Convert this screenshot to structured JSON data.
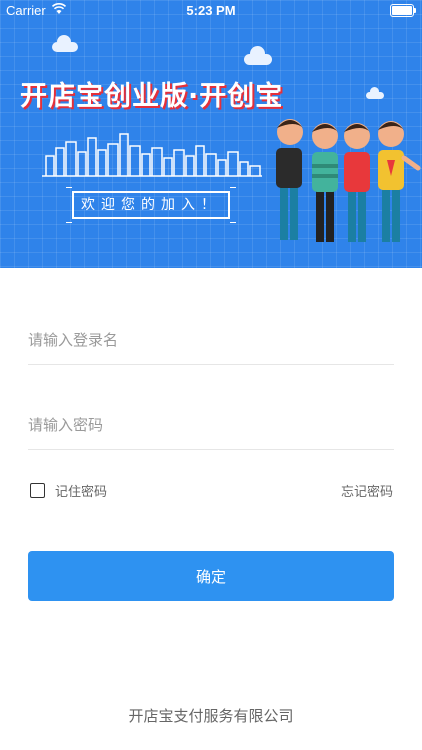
{
  "status_bar": {
    "carrier": "Carrier",
    "time": "5:23 PM",
    "icons": [
      "wifi-icon",
      "battery-icon"
    ]
  },
  "banner": {
    "title": "开店宝创业版·开创宝",
    "welcome": "欢迎您的加入！",
    "colors": {
      "background": "#2f83ea",
      "title_shadow": "#e4303b"
    }
  },
  "login_form": {
    "username_placeholder": "请输入登录名",
    "password_placeholder": "请输入密码",
    "remember_label": "记住密码",
    "forgot_label": "忘记密码",
    "confirm_label": "确定",
    "confirm_color": "#2e92f1"
  },
  "footer": {
    "company": "开店宝支付服务有限公司"
  }
}
